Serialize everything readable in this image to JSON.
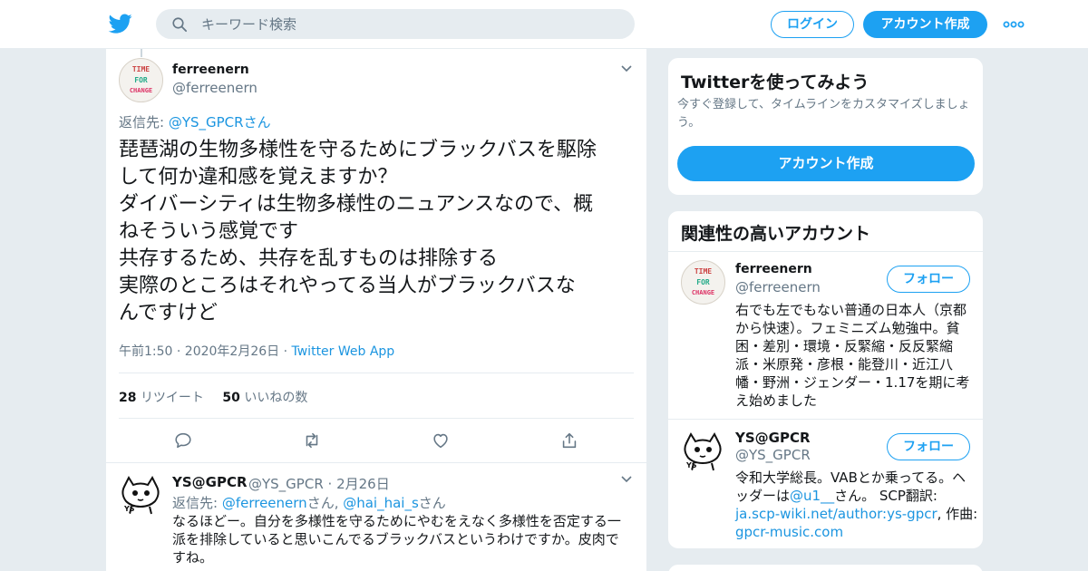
{
  "header": {
    "search_placeholder": "キーワード検索",
    "login_label": "ログイン",
    "signup_label": "アカウント作成"
  },
  "tweet": {
    "author_name": "ferreenern",
    "author_handle": "@ferreenern",
    "reply_prefix": "返信先: ",
    "reply_to": "@YS_GPCR",
    "reply_suffix": "さん",
    "text_lines": [
      "琵琶湖の生物多様性を守るためにブラックバスを駆除",
      "して何か違和感を覚えますか？",
      "ダイバーシティは生物多様性のニュアンスなので、概",
      "ねそういう感覚です",
      "共存するため、共存を乱すものは排除する",
      "実際のところはそれやってる当人がブラックバスな",
      "んですけど"
    ],
    "timestamp": "午前1:50 · 2020年2月26日",
    "separator": "·",
    "source": "Twitter Web App",
    "retweet_count": "28",
    "retweet_label": "リツイート",
    "like_count": "50",
    "like_label": "いいねの数"
  },
  "reply": {
    "author_name": "YS@GPCR",
    "author_handle": "@YS_GPCR",
    "date": "· 2月26日",
    "reply_prefix": "返信先: ",
    "reply_to_1": "@ferreenern",
    "reply_mid": "さん, ",
    "reply_to_2": "@hai_hai_s",
    "reply_suffix": "さん",
    "text": "なるほどー。自分を多様性を守るためにやむをえなく多様性を否定する一派を排除していると思いこんでるブラックバスというわけですか。皮肉ですね。"
  },
  "promo_card": {
    "title": "Twitterを使ってみよう",
    "description": "今すぐ登録して、タイムラインをカスタマイズしましょう。",
    "button_label": "アカウント作成"
  },
  "related_card": {
    "title": "関連性の高いアカウント",
    "follow_label": "フォロー",
    "accounts": [
      {
        "name": "ferreenern",
        "handle": "@ferreenern",
        "bio_lines": [
          "右でも左でもない普通の日本人（京都",
          "から快速）。フェミニズム勉強中。貧",
          "困・差別・環境・反緊縮・反反緊縮",
          "派・米原発・彦根・能登川・近江八",
          "幡・野洲・ジェンダー・1.17を期に考",
          "え始めました"
        ]
      },
      {
        "name": "YS@GPCR",
        "handle": "@YS_GPCR",
        "bio_line1": "令和大学総長。VABとか乗ってる。ヘ",
        "bio_line2_a": "ッダーは",
        "bio_line2_link": "@u1__",
        "bio_line2_b": "さん。 SCP翻訳:",
        "bio_link1": "ja.scp-wiki.net/author:ys-gpcr",
        "bio_line3_b": ", 作曲:",
        "bio_link2": "gpcr-music.com"
      }
    ]
  },
  "avatar_text": {
    "line1": "TIME",
    "line2": "FOR",
    "line3": "CHANGE",
    "ys_mark": "YS"
  },
  "colors": {
    "accent": "#1da1f2",
    "link": "#1b95e0",
    "secondary_text": "#657786",
    "background": "#e6ecf0"
  }
}
